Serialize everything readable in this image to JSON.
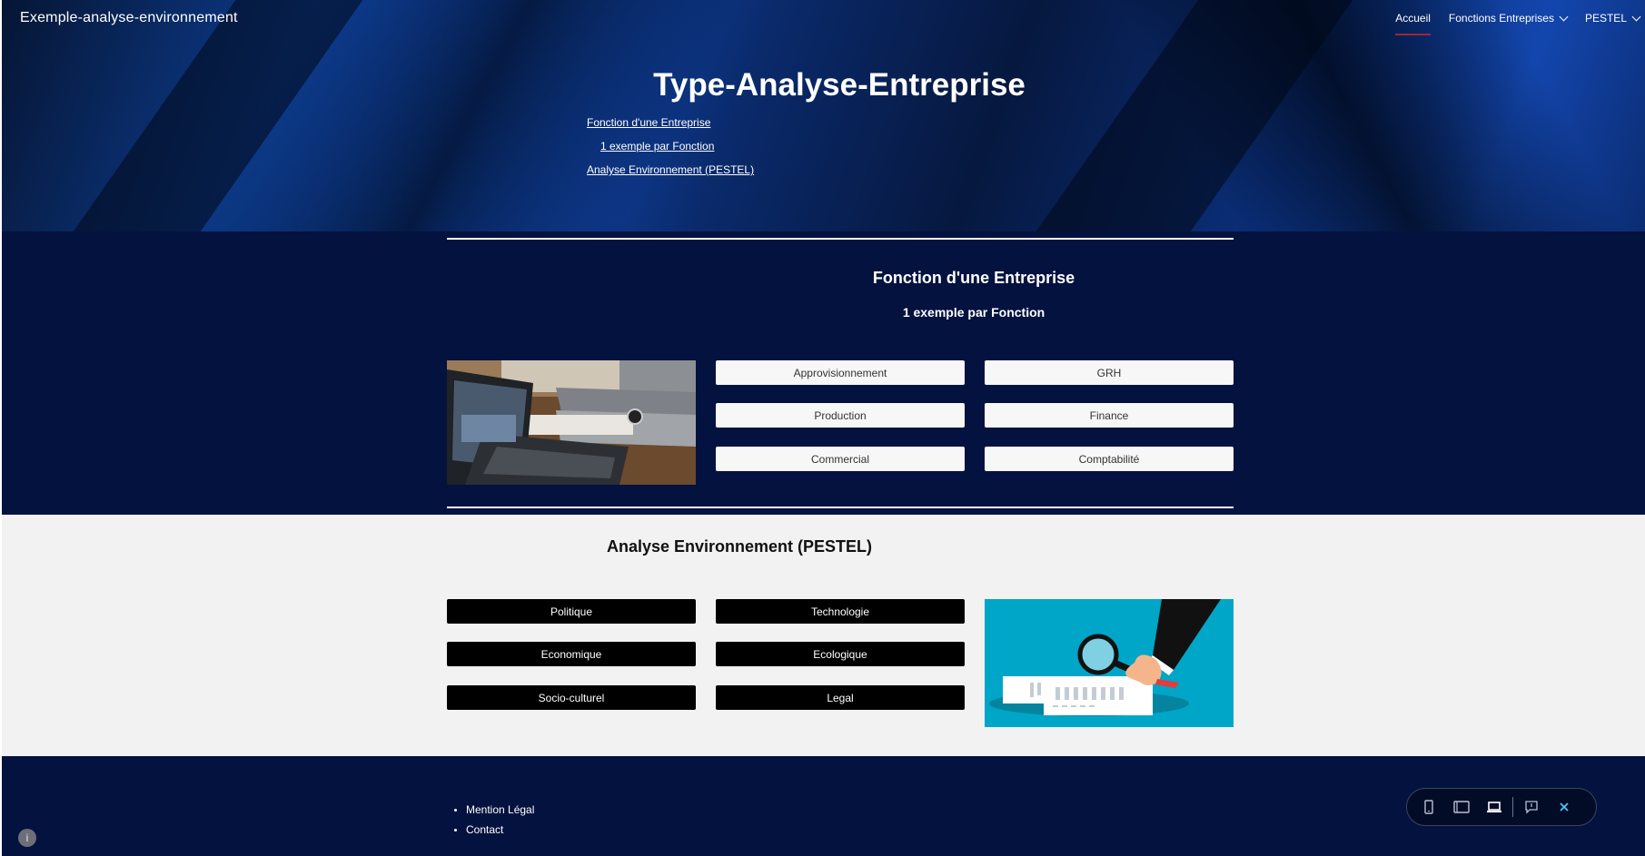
{
  "header": {
    "site_title": "Exemple-analyse-environnement",
    "nav": [
      {
        "label": "Accueil",
        "active": true
      },
      {
        "label": "Fonctions Entreprises",
        "has_dropdown": true
      },
      {
        "label": "PESTEL",
        "has_dropdown": true
      }
    ]
  },
  "hero": {
    "title": "Type-Analyse-Entreprise",
    "toc": [
      "Fonction d'une Entreprise",
      "1 exemple par Fonction",
      "Analyse Environnement (PESTEL)"
    ]
  },
  "section_functions": {
    "heading": "Fonction d'une Entreprise",
    "subheading": "1 exemple par Fonction",
    "image_icon": "laptop-photo-icon",
    "buttons": [
      "Approvisionnement",
      "GRH",
      "Production",
      "Finance",
      "Commercial",
      "Comptabilité"
    ]
  },
  "section_pestel": {
    "heading": "Analyse Environnement (PESTEL)",
    "buttons": [
      "Politique",
      "Technologie",
      "Economique",
      "Ecologique",
      "Socio-culturel",
      "Legal"
    ],
    "image_icon": "magnifier-illustration-icon"
  },
  "footer": {
    "links": [
      "Mention Légal",
      "Contact"
    ]
  },
  "info_button": {
    "glyph": "i",
    "icon": "info-icon"
  },
  "view_toolbar": {
    "icons": [
      "phone-view-icon",
      "tablet-view-icon",
      "laptop-view-icon",
      "feedback-icon",
      "close-icon"
    ],
    "active": "laptop-view-icon"
  },
  "colors": {
    "navy": "#04123f",
    "light_bg": "#f2f2f2",
    "accent_underline": "#a02538",
    "illustration_bg": "#00a6c8",
    "toolbar_accent": "#4fc3f7"
  }
}
